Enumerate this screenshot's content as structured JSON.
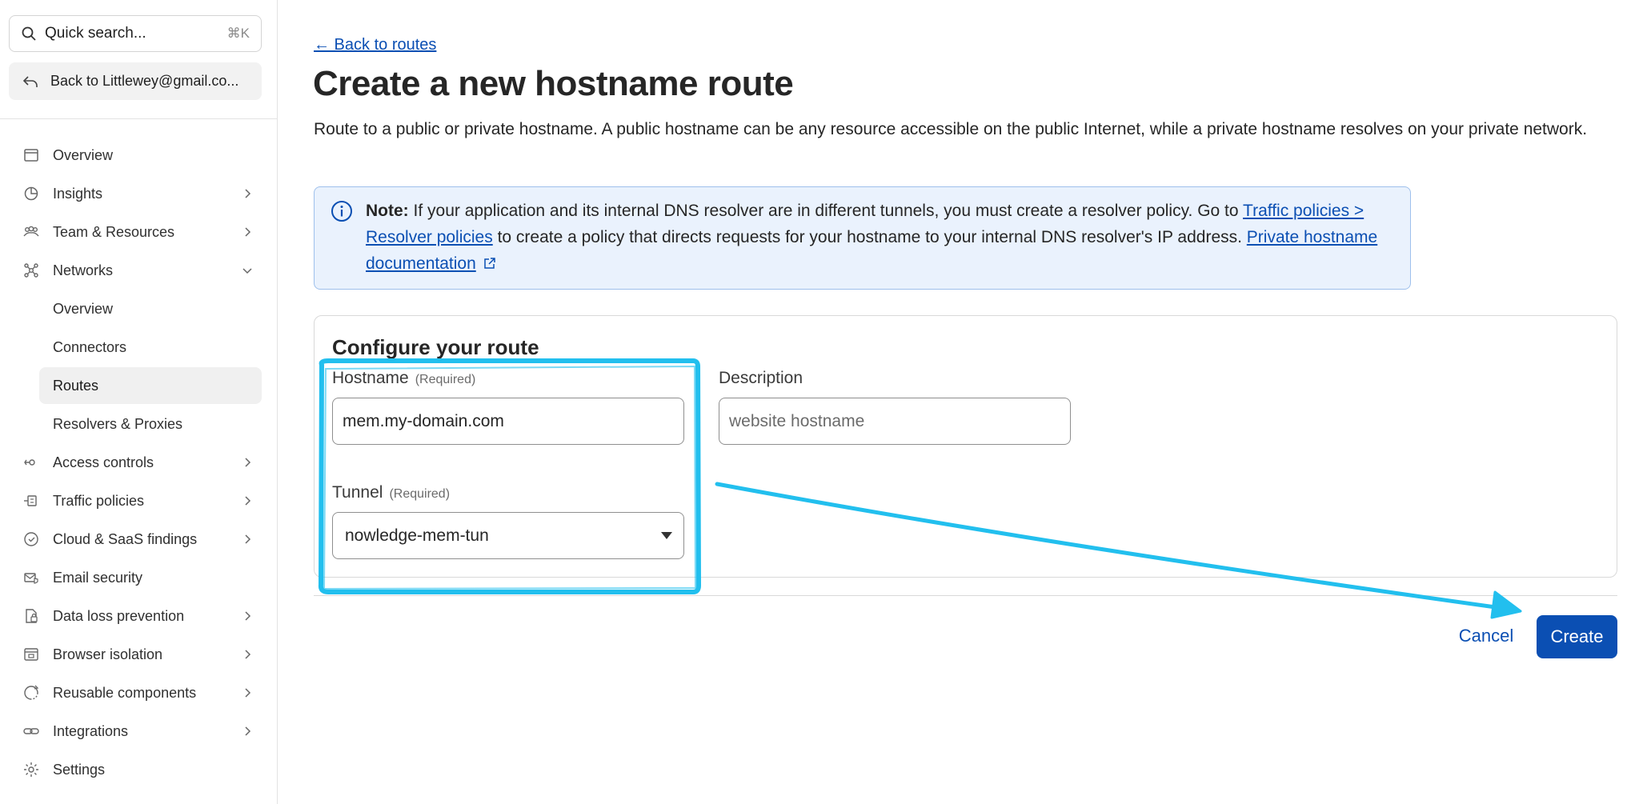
{
  "sidebar": {
    "search": {
      "placeholder": "Quick search...",
      "shortcut": "⌘K"
    },
    "back_account": "Back to Littlewey@gmail.co...",
    "items": [
      {
        "label": "Overview",
        "icon": "window-icon"
      },
      {
        "label": "Insights",
        "icon": "pie-chart-icon"
      },
      {
        "label": "Team & Resources",
        "icon": "team-icon"
      },
      {
        "label": "Networks",
        "icon": "network-icon"
      },
      {
        "label": "Access controls",
        "icon": "access-icon"
      },
      {
        "label": "Traffic policies",
        "icon": "traffic-icon"
      },
      {
        "label": "Cloud & SaaS findings",
        "icon": "cloud-icon"
      },
      {
        "label": "Email security",
        "icon": "email-security-icon"
      },
      {
        "label": "Data loss prevention",
        "icon": "dlp-icon"
      },
      {
        "label": "Browser isolation",
        "icon": "browser-icon"
      },
      {
        "label": "Reusable components",
        "icon": "components-icon"
      },
      {
        "label": "Integrations",
        "icon": "integrations-icon"
      },
      {
        "label": "Settings",
        "icon": "gear-icon"
      }
    ],
    "networks_sub": [
      {
        "label": "Overview"
      },
      {
        "label": "Connectors"
      },
      {
        "label": "Routes",
        "active": true
      },
      {
        "label": "Resolvers & Proxies"
      }
    ]
  },
  "main": {
    "back_link": "← Back to routes",
    "title": "Create a new hostname route",
    "description": "Route to a public or private hostname. A public hostname can be any resource accessible on the public Internet, while a private hostname resolves on your private network.",
    "note": {
      "label": "Note:",
      "text_1": " If your application and its internal DNS resolver are in different tunnels, you must create a resolver policy. Go to ",
      "link_1": "Traffic policies > Resolver policies",
      "text_2": " to create a policy that directs requests for your hostname to your internal DNS resolver's IP address. ",
      "link_2": "Private hostname documentation"
    },
    "form": {
      "title": "Configure your route",
      "hostname": {
        "label": "Hostname",
        "required": "(Required)",
        "value": "mem.my-domain.com"
      },
      "description": {
        "label": "Description",
        "placeholder": "website hostname"
      },
      "tunnel": {
        "label": "Tunnel",
        "required": "(Required)",
        "value": "nowledge-mem-tun"
      }
    },
    "actions": {
      "cancel": "Cancel",
      "create": "Create"
    }
  },
  "colors": {
    "accent": "#0b4fb3",
    "annotation": "#22bfee",
    "note_bg": "#eaf2fd"
  }
}
